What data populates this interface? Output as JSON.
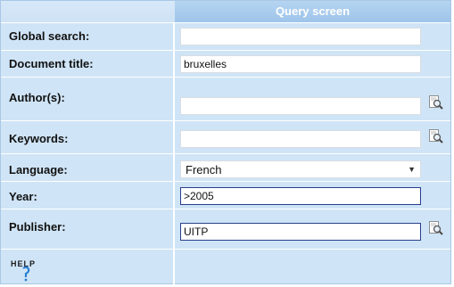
{
  "header": {
    "title": "Query screen"
  },
  "fields": [
    {
      "label": "Global search:",
      "value": "",
      "type": "text"
    },
    {
      "label": "Document title:",
      "value": "bruxelles",
      "type": "text"
    },
    {
      "label": "Author(s):",
      "value": "",
      "type": "text",
      "lookup": "magnifier-icon"
    },
    {
      "label": "Keywords:",
      "value": "",
      "type": "text",
      "lookup": "magnifier-icon"
    },
    {
      "label": "Language:",
      "value": "French",
      "type": "select"
    },
    {
      "label": "Year:",
      "value": ">2005",
      "type": "text"
    },
    {
      "label": "Publisher:",
      "value": "UITP",
      "type": "text",
      "lookup": "magnifier-icon"
    }
  ],
  "help": {
    "icon": "help-icon",
    "text": "HELP"
  },
  "colors": {
    "panel_bg": "#cfe4f6",
    "header_title_bg": "#a9cbee",
    "active_border": "#273f8c"
  }
}
